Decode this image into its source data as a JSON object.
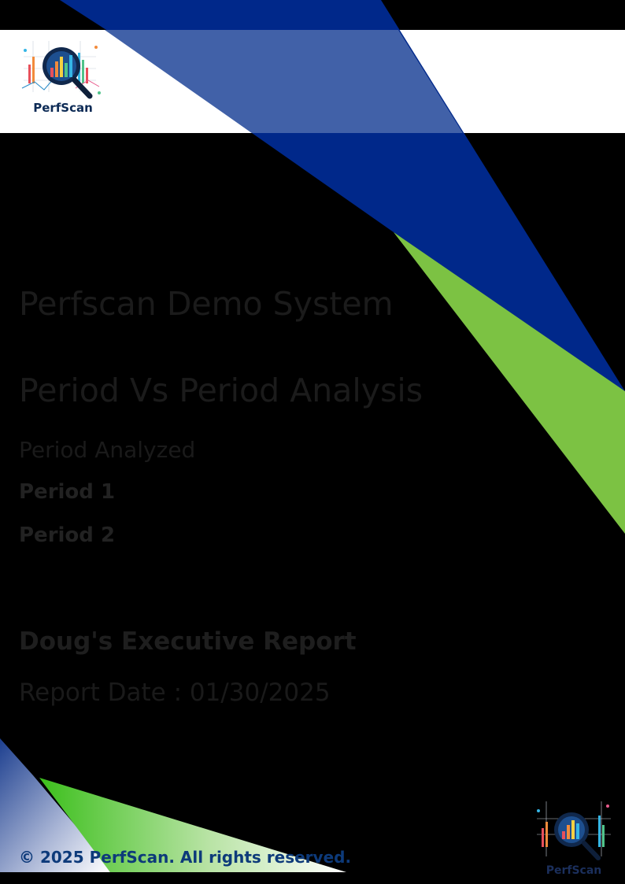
{
  "colors": {
    "page_background": "#000000",
    "header_band": "#ffffff",
    "accent_blue": "#00288a",
    "accent_green": "#7cc243",
    "footer_blue": "#0d3a7a"
  },
  "logo": {
    "wordmark": "PerfScan",
    "icon": "magnifier-chart-icon"
  },
  "cover": {
    "system_name": "Perfscan Demo System",
    "analysis_title": "Period Vs Period Analysis",
    "period_analyzed_label": "Period Analyzed",
    "period_1": "Period 1",
    "period_2": "Period 2",
    "report_title": "Doug's Executive Report",
    "report_date": "Report Date : 01/30/2025"
  },
  "footer": {
    "copyright": "© 2025 PerfScan. All rights reserved."
  }
}
